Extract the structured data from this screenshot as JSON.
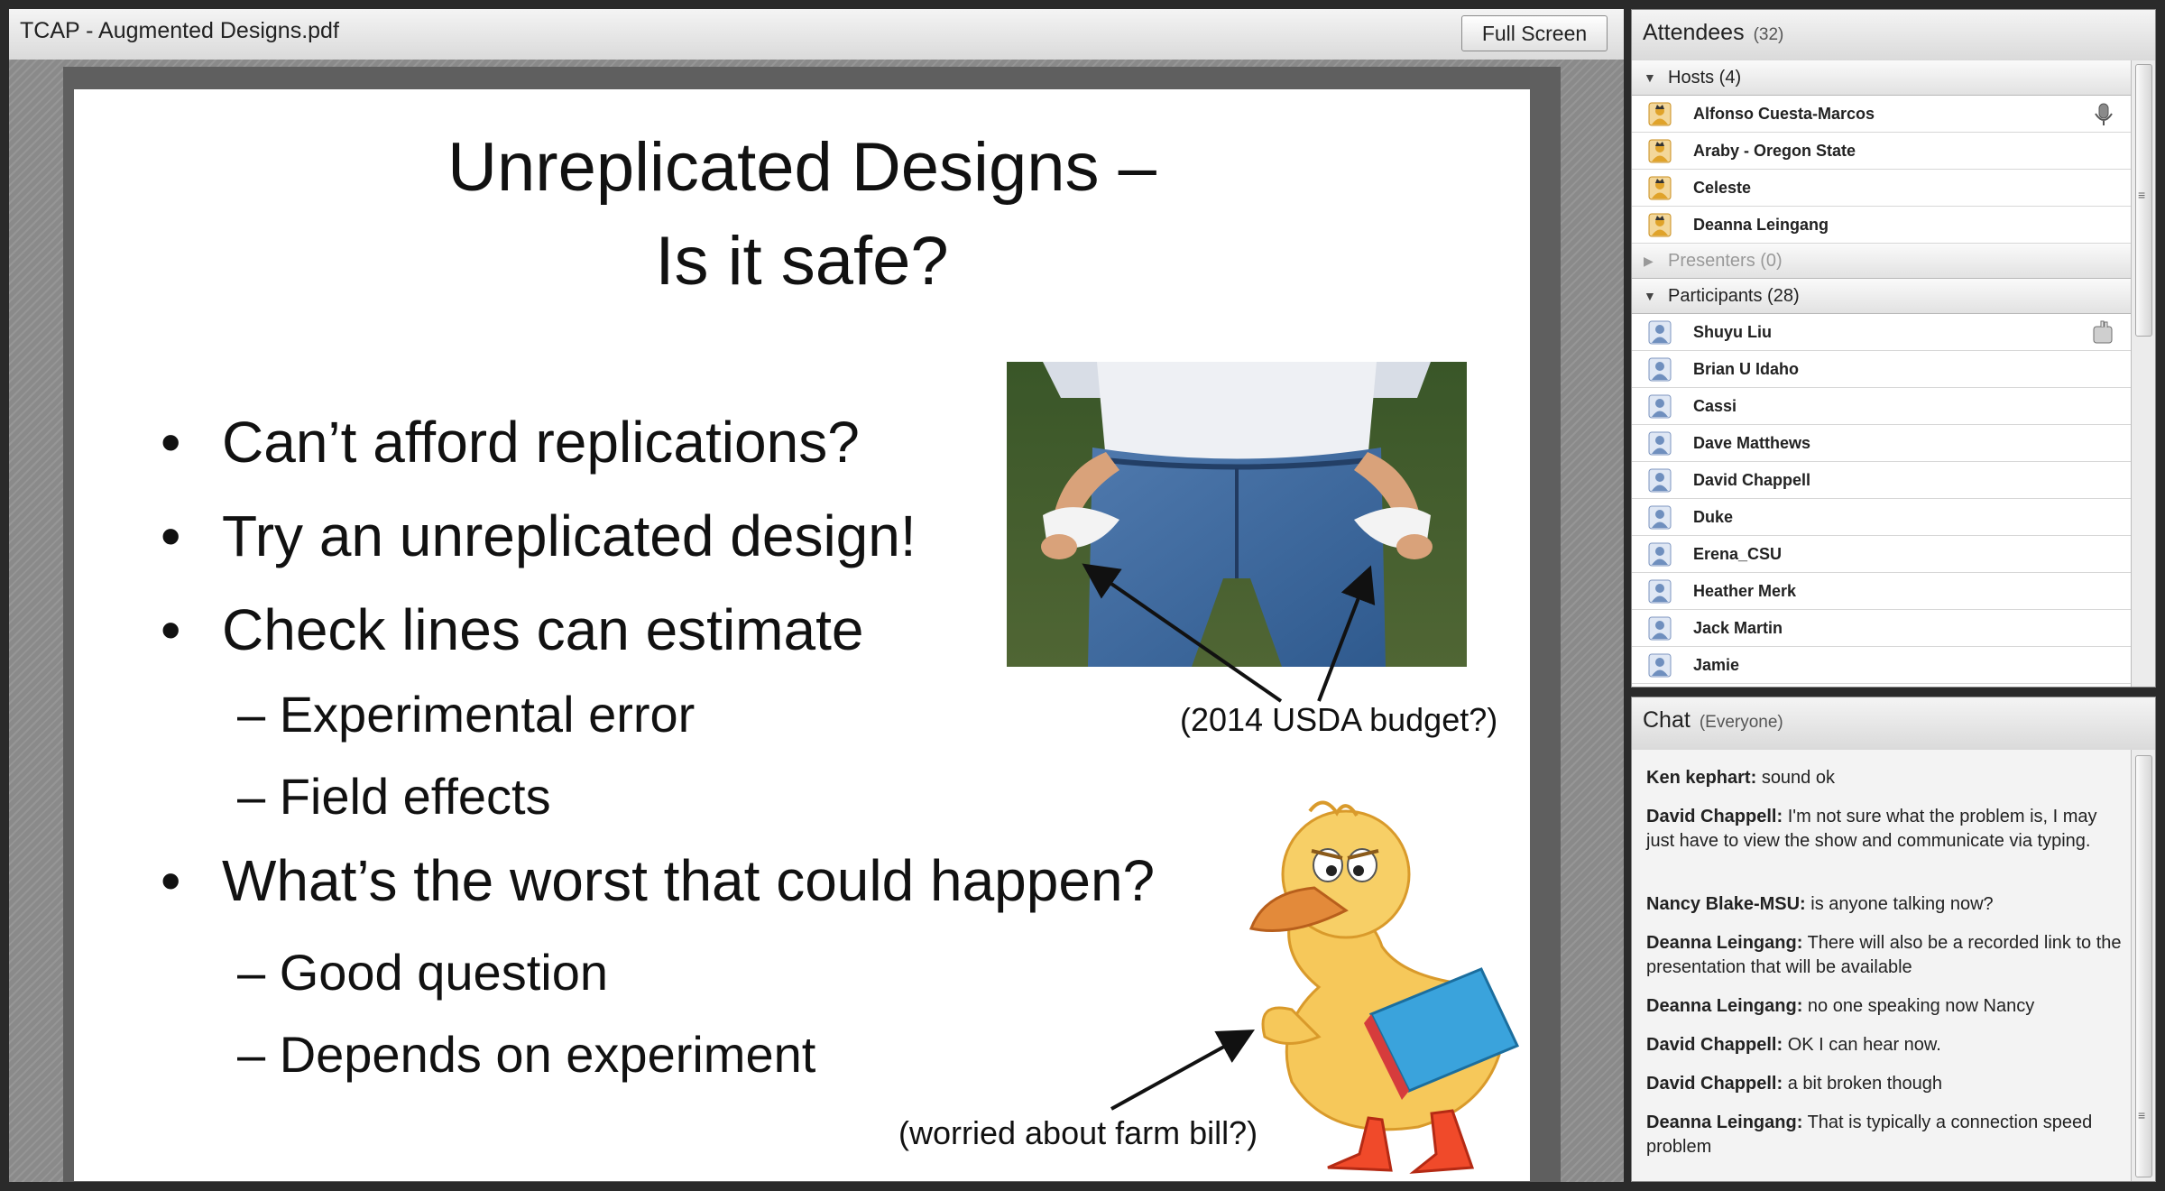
{
  "share_pod": {
    "title": "TCAP - Augmented Designs.pdf",
    "fullscreen_label": "Full Screen"
  },
  "slide": {
    "title_line1": "Unreplicated Designs –",
    "title_line2": "Is it safe?",
    "bullet_glyph": "•",
    "bullets": [
      "Can’t afford replications?",
      "Try an unreplicated design!",
      "Check lines can estimate",
      "What’s the worst that could happen?"
    ],
    "subbullets": [
      "– Experimental error",
      "– Field effects",
      "– Good question",
      "– Depends on experiment"
    ],
    "callout_budget": "(2014 USDA budget?)",
    "callout_farm": "(worried about farm bill?)"
  },
  "attendees": {
    "title": "Attendees",
    "count": "(32)",
    "groups": {
      "hosts": "Hosts (4)",
      "presenters": "Presenters (0)",
      "participants": "Participants (28)"
    },
    "hosts": [
      "Alfonso Cuesta-Marcos",
      "Araby - Oregon State",
      "Celeste",
      "Deanna Leingang"
    ],
    "participants": [
      "Shuyu Liu",
      "Brian U Idaho",
      "Cassi",
      "Dave Matthews",
      "David Chappell",
      "Duke",
      "Erena_CSU",
      "Heather Merk",
      "Jack Martin",
      "Jamie"
    ],
    "icons": {
      "host": "host-person-icon",
      "participant": "participant-person-icon",
      "speaking": "microphone-icon",
      "raised_hand": "raised-hand-icon"
    },
    "colors": {
      "host_icon": "#e0a32a",
      "participant_icon": "#6f8fbe"
    }
  },
  "chat": {
    "title": "Chat",
    "audience": "(Everyone)",
    "messages": [
      {
        "sender": "Ken kephart:",
        "text": "sound ok"
      },
      {
        "sender": "David Chappell:",
        "text": "I'm not sure what the problem is, I may just have to view the show and communicate via typing."
      },
      {
        "sender": "Nancy Blake-MSU:",
        "text": "is anyone talking now?"
      },
      {
        "sender": "Deanna Leingang:",
        "text": "There will also be a recorded link to the presentation that will be available"
      },
      {
        "sender": "Deanna Leingang:",
        "text": "no one speaking now Nancy"
      },
      {
        "sender": "David Chappell:",
        "text": "OK I can hear now."
      },
      {
        "sender": "David Chappell:",
        "text": "a bit broken though"
      },
      {
        "sender": "Deanna Leingang:",
        "text": "That is typically a connection speed problem"
      }
    ]
  }
}
